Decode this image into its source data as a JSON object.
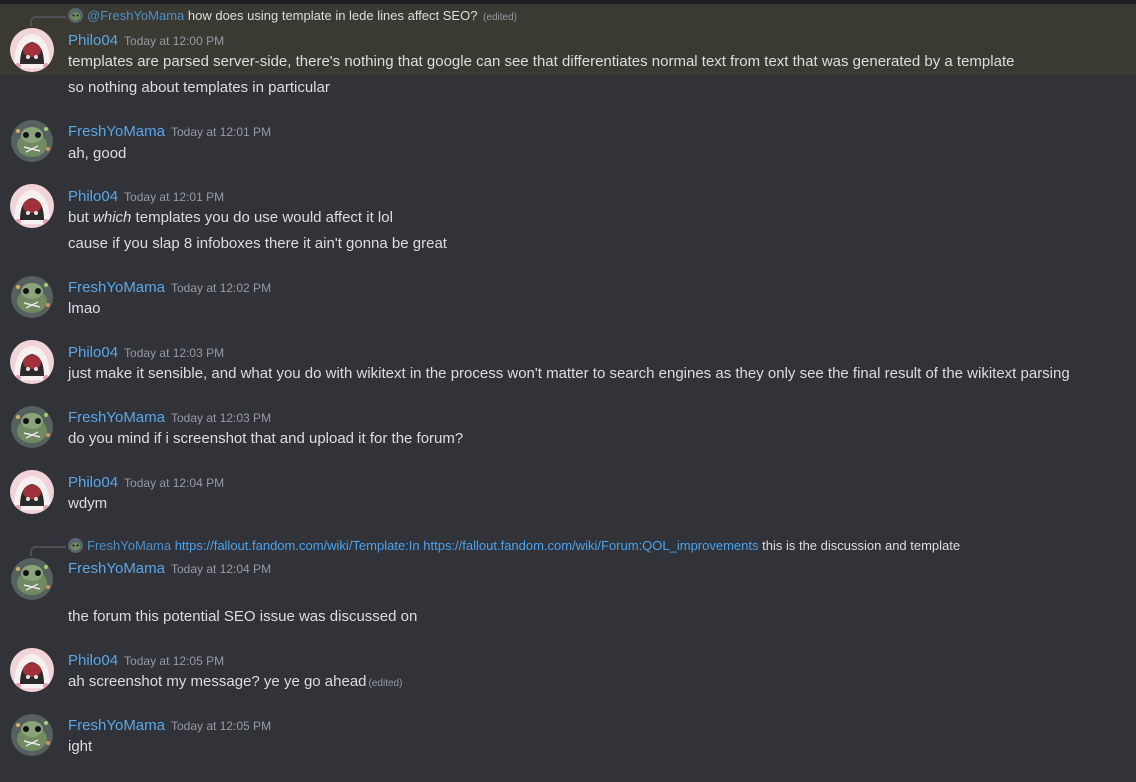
{
  "reply_top": {
    "mention": "@FreshYoMama",
    "text": "how does using template in lede lines affect SEO?",
    "edited": "(edited)"
  },
  "messages": [
    {
      "author": "Philo04",
      "time": "Today at 12:00 PM",
      "lines": [
        "templates are parsed server-side, there's nothing that google can see that differentiates normal text from text that was generated by a template",
        "so nothing about templates in particular"
      ]
    },
    {
      "author": "FreshYoMama",
      "time": "Today at 12:01 PM",
      "lines": [
        "ah, good"
      ]
    },
    {
      "author": "Philo04",
      "time": "Today at 12:01 PM",
      "line1_pre": "but ",
      "line1_em": "which",
      "line1_post": " templates you do use would affect it lol",
      "line2": "cause if you slap 8 infoboxes there it ain't gonna be great"
    },
    {
      "author": "FreshYoMama",
      "time": "Today at 12:02 PM",
      "lines": [
        "lmao"
      ]
    },
    {
      "author": "Philo04",
      "time": "Today at 12:03 PM",
      "lines": [
        "just make it sensible, and what you do with wikitext in the process won't matter to search engines as they only see the final result of the wikitext parsing"
      ]
    },
    {
      "author": "FreshYoMama",
      "time": "Today at 12:03 PM",
      "lines": [
        "do you mind if i screenshot that and upload it for the forum?"
      ]
    },
    {
      "author": "Philo04",
      "time": "Today at 12:04 PM",
      "lines": [
        "wdym"
      ]
    },
    {
      "author": "FreshYoMama",
      "time": "Today at 12:04 PM",
      "lines": [
        "the forum this potential SEO issue was discussed on"
      ]
    },
    {
      "author": "Philo04",
      "time": "Today at 12:05 PM",
      "lines": [
        "ah screenshot my message? ye ye go ahead"
      ],
      "edited": "(edited)"
    },
    {
      "author": "FreshYoMama",
      "time": "Today at 12:05 PM",
      "lines": [
        "ight"
      ]
    }
  ],
  "reply_mid": {
    "name": "FreshYoMama",
    "link1": "https://fallout.fandom.com/wiki/Template:In",
    "link2": "https://fallout.fandom.com/wiki/Forum:QOL_improvements",
    "text": "this is the discussion and template"
  },
  "colors": {
    "background": "#313338",
    "username": "#5aa7e8",
    "highlight": "#3a3a33",
    "link": "#4aa3ef"
  },
  "icons": {
    "philo_avatar": "pink-hooded-cat-avatar",
    "fresh_avatar": "green-tree-frog-avatar"
  }
}
